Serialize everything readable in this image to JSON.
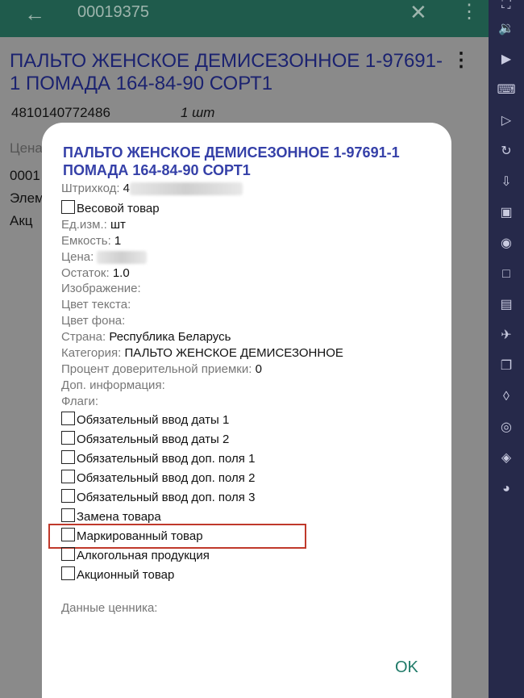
{
  "appbar": {
    "back_icon": "arrow-back-icon",
    "title": "00019375",
    "close_icon": "close-icon",
    "more_icon": "more-vertical-icon"
  },
  "background": {
    "product_title": "ПАЛЬТО ЖЕНСКОЕ ДЕМИСЕЗОННОЕ 1-97691-1 ПОМАДА 164-84-90 СОРТ1",
    "barcode": "4810140772486",
    "quantity": "1  шт",
    "frag_price": "Цена",
    "frag_code": "0001",
    "frag_elem": "Элем",
    "frag_akc": "Акц"
  },
  "dialog": {
    "title": "ПАЛЬТО ЖЕНСКОЕ ДЕМИСЕЗОННОЕ 1-97691-1 ПОМАДА 164-84-90 СОРТ1",
    "barcode_label": "Штрихкод: ",
    "barcode_value": "4",
    "weight_item": "Весовой товар",
    "unit_label": "Ед.изм.: ",
    "unit_value": "шт",
    "capacity_label": "Емкость: ",
    "capacity_value": "1",
    "price_label": "Цена: ",
    "stock_label": "Остаток: ",
    "stock_value": "1.0",
    "image_label": "Изображение:",
    "text_color_label": "Цвет текста:",
    "bg_color_label": "Цвет фона:",
    "country_label": "Страна: ",
    "country_value": "Республика Беларусь",
    "category_label": "Категория: ",
    "category_value": "ПАЛЬТО ЖЕНСКОЕ ДЕМИСЕЗОННОЕ",
    "trust_label": "Процент доверительной приемки: ",
    "trust_value": "0",
    "extra_label": "Доп. информация:",
    "flags_label": "Флаги:",
    "flags": [
      "Обязательный ввод даты 1",
      "Обязательный ввод даты 2",
      "Обязательный ввод доп. поля 1",
      "Обязательный ввод доп. поля 2",
      "Обязательный ввод доп. поля 3",
      "Замена товара",
      "Маркированный товар",
      "Алкогольная продукция",
      "Акционный товар"
    ],
    "price_tag_label": "Данные ценника:",
    "ok_label": "OK"
  },
  "toolbar_icons": [
    "fullscreen-icon",
    "volume-icon",
    "play-store-icon",
    "keyboard-icon",
    "play-icon",
    "rotate-icon",
    "apk-install-icon",
    "apk-icon",
    "screenshot-icon",
    "screen-record-icon",
    "folder-icon",
    "airplane-icon",
    "multi-window-icon",
    "shake-icon",
    "location-icon",
    "layers-icon",
    "speed-icon"
  ]
}
